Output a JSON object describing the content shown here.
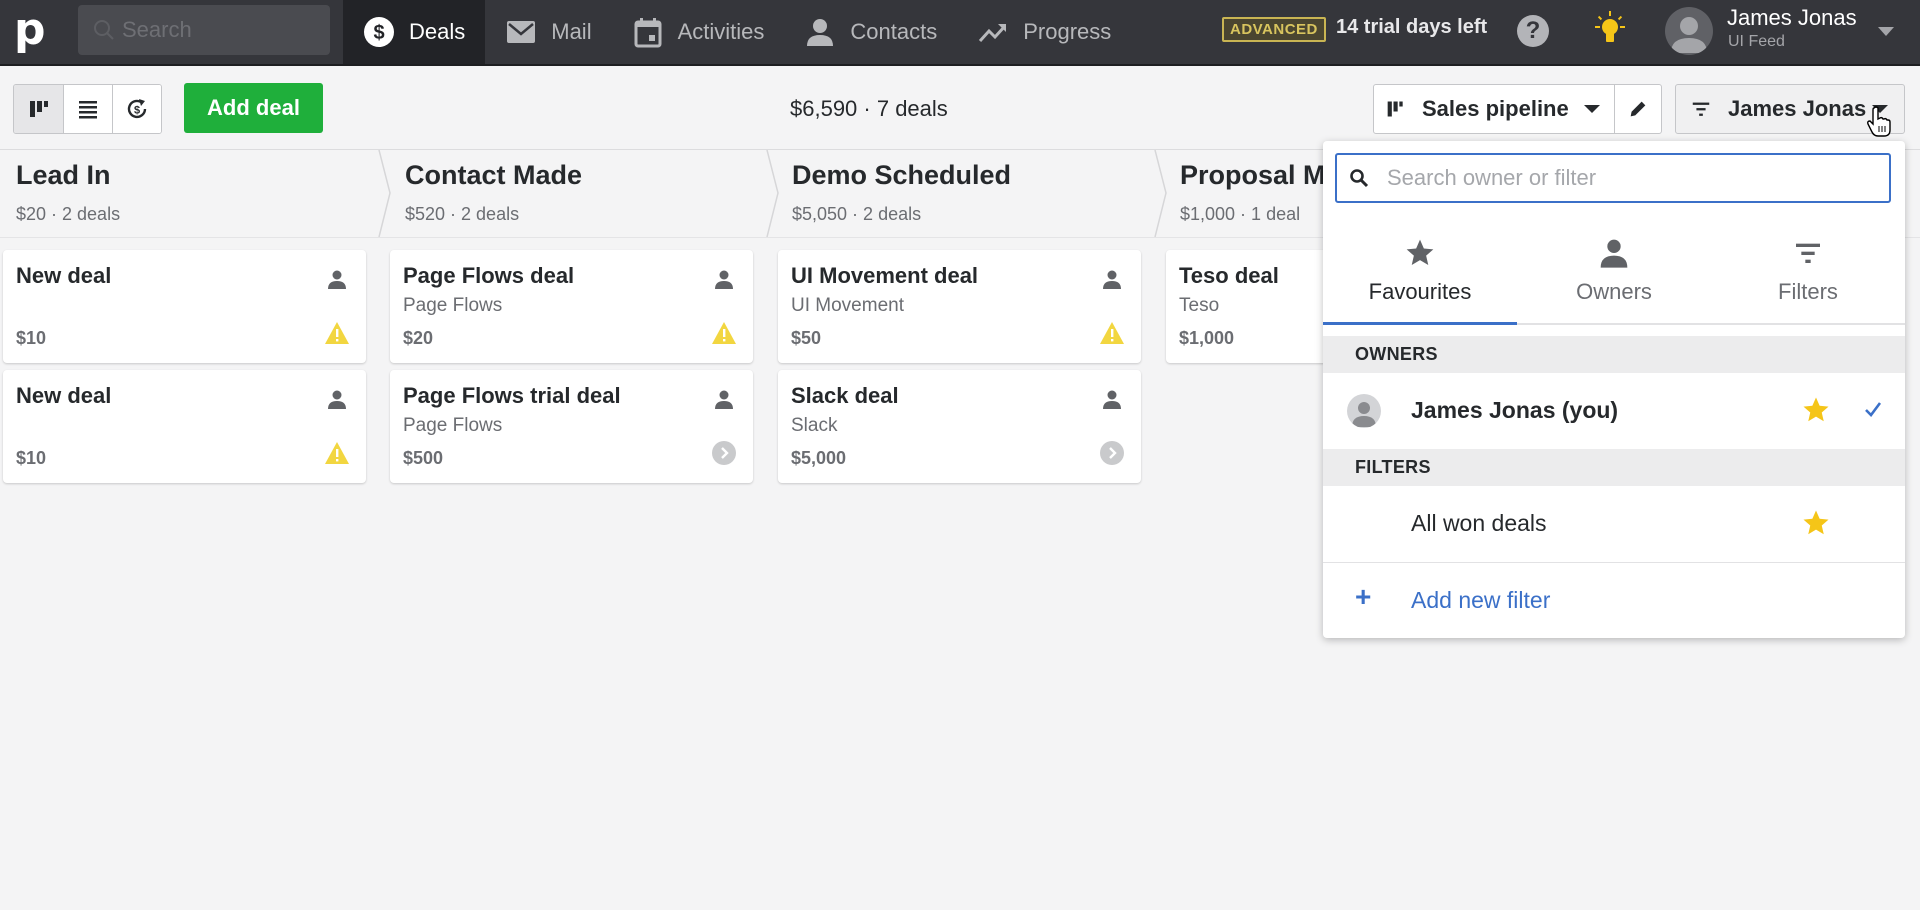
{
  "topbar": {
    "logo": "p",
    "search_placeholder": "Search",
    "nav": [
      {
        "label": "Deals",
        "icon": "dollar-circle-icon",
        "active": true
      },
      {
        "label": "Mail",
        "icon": "mail-icon",
        "active": false
      },
      {
        "label": "Activities",
        "icon": "calendar-icon",
        "active": false
      },
      {
        "label": "Contacts",
        "icon": "person-icon",
        "active": false
      },
      {
        "label": "Progress",
        "icon": "trending-up-icon",
        "active": false
      }
    ],
    "plan_badge": "ADVANCED",
    "trial_text": "14 trial days left",
    "help_label": "?",
    "user": {
      "name": "James Jonas",
      "company": "UI Feed"
    }
  },
  "toolbar": {
    "views": [
      "pipeline-view",
      "list-view",
      "forecast-view"
    ],
    "add_deal_label": "Add deal",
    "summary": "$6,590 · 7 deals",
    "pipeline_label": "Sales pipeline",
    "owner_filter_label": "James Jonas"
  },
  "stages": [
    {
      "title": "Lead In",
      "meta": "$20 · 2 deals",
      "deals": [
        {
          "title": "New deal",
          "org": "",
          "value": "$10",
          "status": "warning"
        },
        {
          "title": "New deal",
          "org": "",
          "value": "$10",
          "status": "warning"
        }
      ]
    },
    {
      "title": "Contact Made",
      "meta": "$520 · 2 deals",
      "deals": [
        {
          "title": "Page Flows deal",
          "org": "Page Flows",
          "value": "$20",
          "status": "warning"
        },
        {
          "title": "Page Flows trial deal",
          "org": "Page Flows",
          "value": "$500",
          "status": "next"
        }
      ]
    },
    {
      "title": "Demo Scheduled",
      "meta": "$5,050 · 2 deals",
      "deals": [
        {
          "title": "UI Movement deal",
          "org": "UI Movement",
          "value": "$50",
          "status": "warning"
        },
        {
          "title": "Slack deal",
          "org": "Slack",
          "value": "$5,000",
          "status": "next"
        }
      ]
    },
    {
      "title": "Proposal Made",
      "meta": "$1,000 · 1 deal",
      "deals": [
        {
          "title": "Teso deal",
          "org": "Teso",
          "value": "$1,000",
          "status": ""
        }
      ]
    }
  ],
  "dropdown": {
    "search_placeholder": "Search owner or filter",
    "tabs": [
      {
        "label": "Favourites",
        "icon": "star-icon",
        "active": true
      },
      {
        "label": "Owners",
        "icon": "person-icon",
        "active": false
      },
      {
        "label": "Filters",
        "icon": "filter-icon",
        "active": false
      }
    ],
    "owners_heading": "OWNERS",
    "owners": [
      {
        "label": "James Jonas (you)",
        "favourite": true,
        "selected": true
      }
    ],
    "filters_heading": "FILTERS",
    "filters": [
      {
        "label": "All won deals",
        "favourite": true
      }
    ],
    "add_filter_label": "Add new filter",
    "add_icon": "+"
  },
  "colors": {
    "brand_green": "#1faf3b",
    "accent_blue": "#3b70c8",
    "star_yellow": "#f5c518",
    "warning_yellow": "#f2d640",
    "topbar_bg": "#35363b"
  }
}
